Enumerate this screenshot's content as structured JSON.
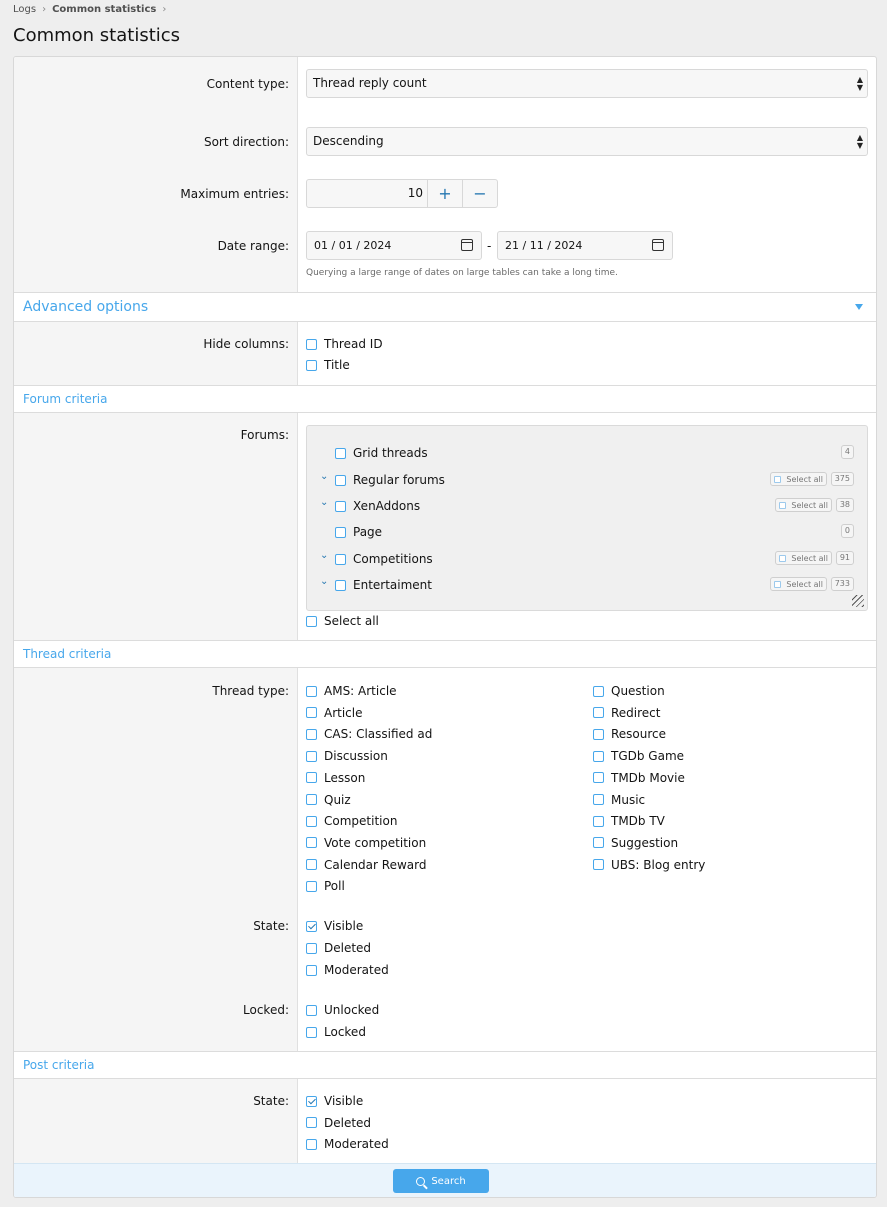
{
  "breadcrumb": {
    "items": [
      "Logs",
      "Common statistics"
    ]
  },
  "page_title": "Common statistics",
  "form": {
    "content_type": {
      "label": "Content type:",
      "value": "Thread reply count"
    },
    "sort_direction": {
      "label": "Sort direction:",
      "value": "Descending"
    },
    "max_entries": {
      "label": "Maximum entries:",
      "value": "10",
      "plus": "+",
      "minus": "−"
    },
    "date_range": {
      "label": "Date range:",
      "start": "01 / 01 / 2024",
      "end": "21 / 11 / 2024",
      "separator": "-",
      "hint": "Querying a large range of dates on large tables can take a long time."
    }
  },
  "advanced": {
    "title": "Advanced options",
    "hide_columns": {
      "label": "Hide columns:",
      "options": [
        "Thread ID",
        "Title"
      ]
    }
  },
  "forum_criteria": {
    "title": "Forum criteria",
    "label": "Forums:",
    "select_all_label": "Select all",
    "forums": [
      {
        "name": "Grid threads",
        "count": "4"
      },
      {
        "name": "Regular forums",
        "count": "375"
      },
      {
        "name": "XenAddons",
        "count": "38"
      },
      {
        "name": "Page",
        "count": "0"
      },
      {
        "name": "Competitions",
        "count": "91"
      },
      {
        "name": "Entertaiment",
        "count": "733"
      }
    ],
    "select_all": "Select all"
  },
  "thread_criteria": {
    "title": "Thread criteria",
    "thread_type_label": "Thread type:",
    "thread_types_left": [
      "AMS: Article",
      "Article",
      "CAS: Classified ad",
      "Discussion",
      "Lesson",
      "Quiz",
      "Competition",
      "Vote competition",
      "Calendar Reward",
      "Poll"
    ],
    "thread_types_right": [
      "Question",
      "Redirect",
      "Resource",
      "TGDb Game",
      "TMDb Movie",
      "Music",
      "TMDb TV",
      "Suggestion",
      "UBS: Blog entry"
    ],
    "state_label": "State:",
    "state_options": [
      {
        "label": "Visible",
        "checked": true
      },
      {
        "label": "Deleted",
        "checked": false
      },
      {
        "label": "Moderated",
        "checked": false
      }
    ],
    "locked_label": "Locked:",
    "locked_options": [
      "Unlocked",
      "Locked"
    ]
  },
  "post_criteria": {
    "title": "Post criteria",
    "state_label": "State:",
    "state_options": [
      {
        "label": "Visible",
        "checked": true
      },
      {
        "label": "Deleted",
        "checked": false
      },
      {
        "label": "Moderated",
        "checked": false
      }
    ]
  },
  "search_button": "Search",
  "colors": {
    "accent": "#47a7eb",
    "link": "#2577b1"
  }
}
